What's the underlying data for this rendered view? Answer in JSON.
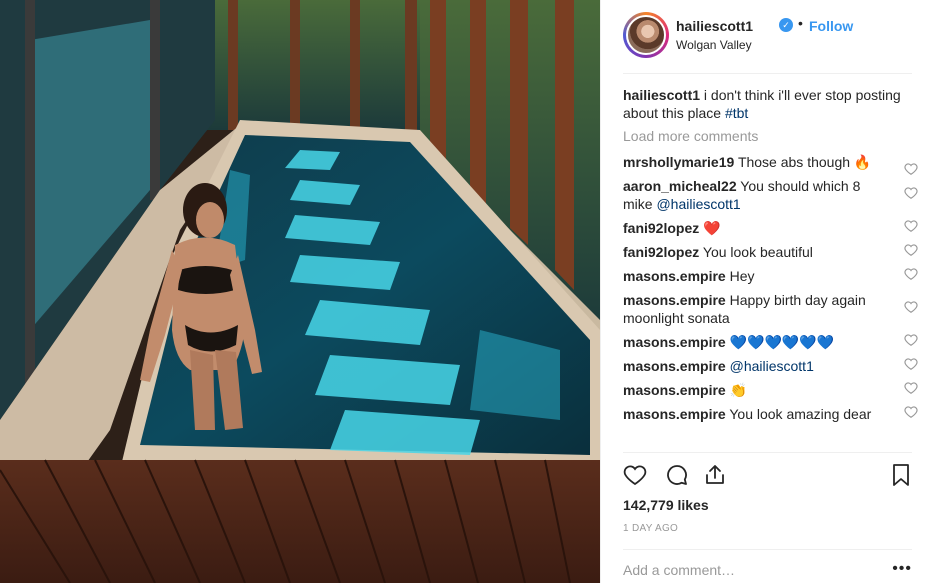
{
  "post": {
    "username": "hailiescott1",
    "follow_label": "Follow",
    "dot": "•",
    "verified_glyph": "✓",
    "location": "Wolgan Valley",
    "likes": "142,779 likes",
    "time": "1 DAY AGO",
    "add_comment_placeholder": "Add a comment…",
    "more_glyph": "•••"
  },
  "caption": {
    "user": "hailiescott1",
    "text": "i don't think i'll ever stop posting about this place",
    "hashtag": "#tbt"
  },
  "load_more": "Load more comments",
  "comments": [
    {
      "user": "mrshollymarie19",
      "text": "Those abs though",
      "emoji": "🔥"
    },
    {
      "user": "aaron_micheal22",
      "text": "You should which 8 mike",
      "mention": "@hailiescott1"
    },
    {
      "user": "fani92lopez",
      "text": "",
      "emoji": "❤️"
    },
    {
      "user": "fani92lopez",
      "text": "You look beautiful"
    },
    {
      "user": "masons.empire",
      "text": "Hey"
    },
    {
      "user": "masons.empire",
      "text": "Happy birth day again moonlight sonata"
    },
    {
      "user": "masons.empire",
      "text": "",
      "emoji": "💙💙💙💙💙💙"
    },
    {
      "user": "masons.empire",
      "text": "",
      "mention": "@hailiescott1"
    },
    {
      "user": "masons.empire",
      "text": "",
      "emoji": "👏"
    },
    {
      "user": "masons.empire",
      "text": "You look amazing dear"
    }
  ],
  "colors": {
    "link_blue": "#3897f0",
    "mention_blue": "#003569",
    "muted": "#999999",
    "text": "#262626"
  },
  "icons": [
    "verified-badge-icon",
    "heart-icon",
    "comment-icon",
    "share-icon",
    "bookmark-icon",
    "more-options-icon"
  ]
}
